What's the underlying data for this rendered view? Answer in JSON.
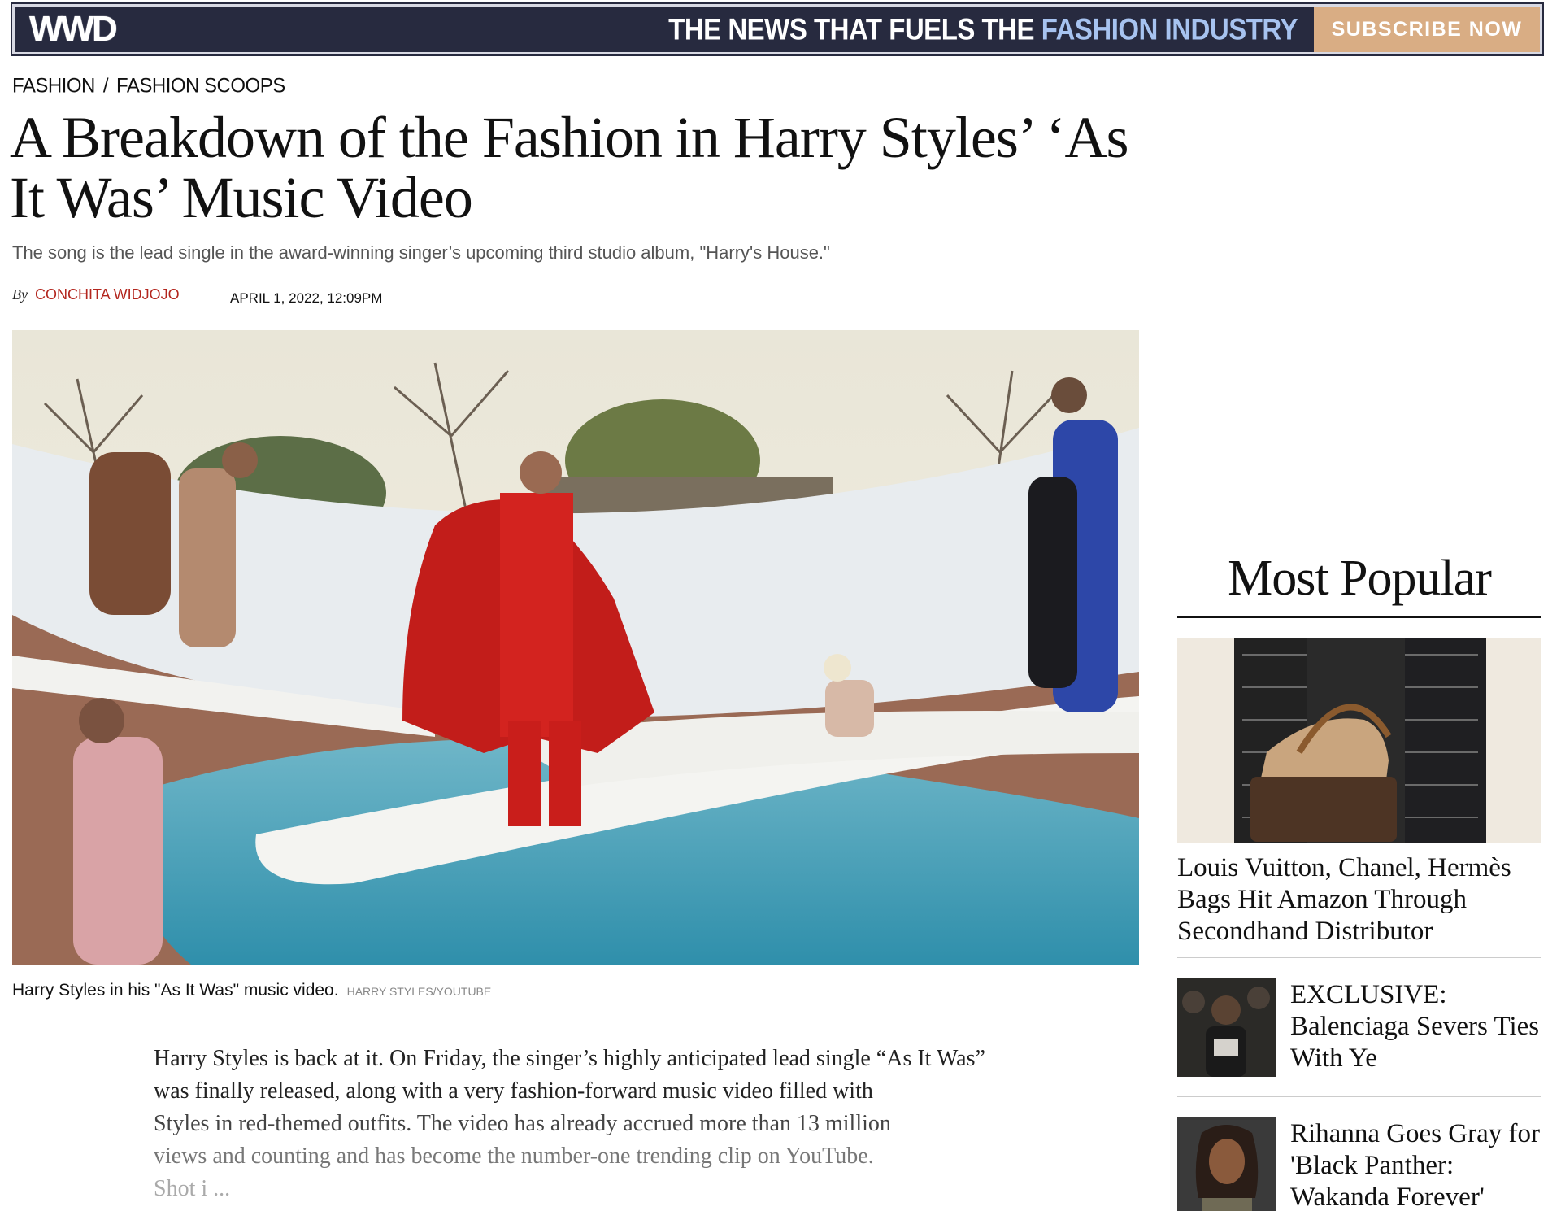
{
  "banner": {
    "logo": "WWD",
    "tagline_main": "THE NEWS THAT FUELS THE ",
    "tagline_accent": "FASHION INDUSTRY",
    "subscribe_label": "SUBSCRIBE NOW"
  },
  "breadcrumb": {
    "section": "FASHION",
    "separator": "/",
    "subsection": "FASHION SCOOPS"
  },
  "article": {
    "headline": "A Breakdown of the Fashion in Harry Styles’ ‘As It Was’ Music Video",
    "dek": "The song is the lead single in the award-winning singer’s upcoming third studio album, \"Harry's House.\"",
    "by_prefix": "By",
    "author": "CONCHITA WIDJOJO",
    "timestamp": "APRIL 1, 2022, 12:09PM",
    "caption": "Harry Styles in his \"As It Was\" music video.",
    "caption_credit": "HARRY STYLES/YOUTUBE",
    "body_1": "Harry Styles is back at it. On Friday, the singer’s highly anticipated lead single “As It Was” was finally released, along with a very fashion-forward music video filled with",
    "body_2": "Styles in red-themed outfits. The video has already accrued more than 13 million",
    "body_3": "views and counting and has become the number-one trending clip on YouTube.",
    "body_4": "Shot i ..."
  },
  "sidebar": {
    "title": "Most Popular",
    "items": [
      {
        "title": "Louis Vuitton, Chanel, Hermès Bags Hit Amazon Through Secondhand Distributor"
      },
      {
        "title": "EXCLUSIVE: Balenciaga Severs Ties With Ye"
      },
      {
        "title": "Rihanna Goes Gray for 'Black Panther: Wakanda Forever'"
      }
    ]
  },
  "colors": {
    "banner_bg": "#272a3f",
    "accent_blue": "#a7c3f0",
    "subscribe_bg": "#d9ad84",
    "author_red": "#b3261e"
  }
}
